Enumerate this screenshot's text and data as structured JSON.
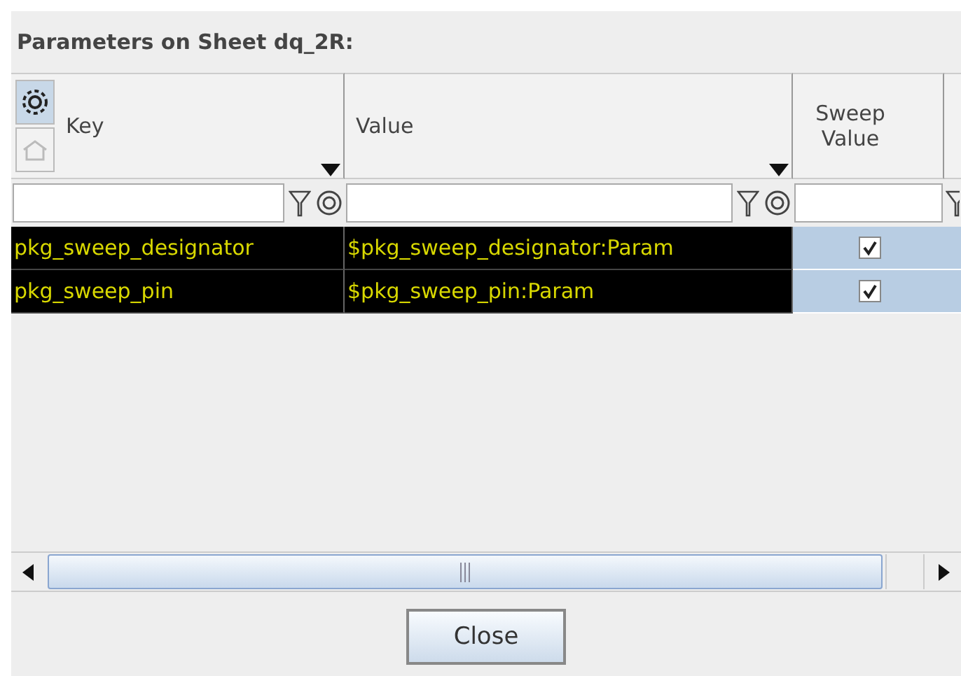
{
  "title": "Parameters on  Sheet dq_2R:",
  "columns": [
    {
      "label": "Key"
    },
    {
      "label": "Value"
    },
    {
      "label": "Sweep Value"
    }
  ],
  "rows": [
    {
      "key": "pkg_sweep_designator",
      "value": "$pkg_sweep_designator:Param",
      "sweep_checked": true,
      "selected": true
    },
    {
      "key": "pkg_sweep_pin",
      "value": "$pkg_sweep_pin:Param",
      "sweep_checked": true,
      "selected": true
    }
  ],
  "button": "Close"
}
